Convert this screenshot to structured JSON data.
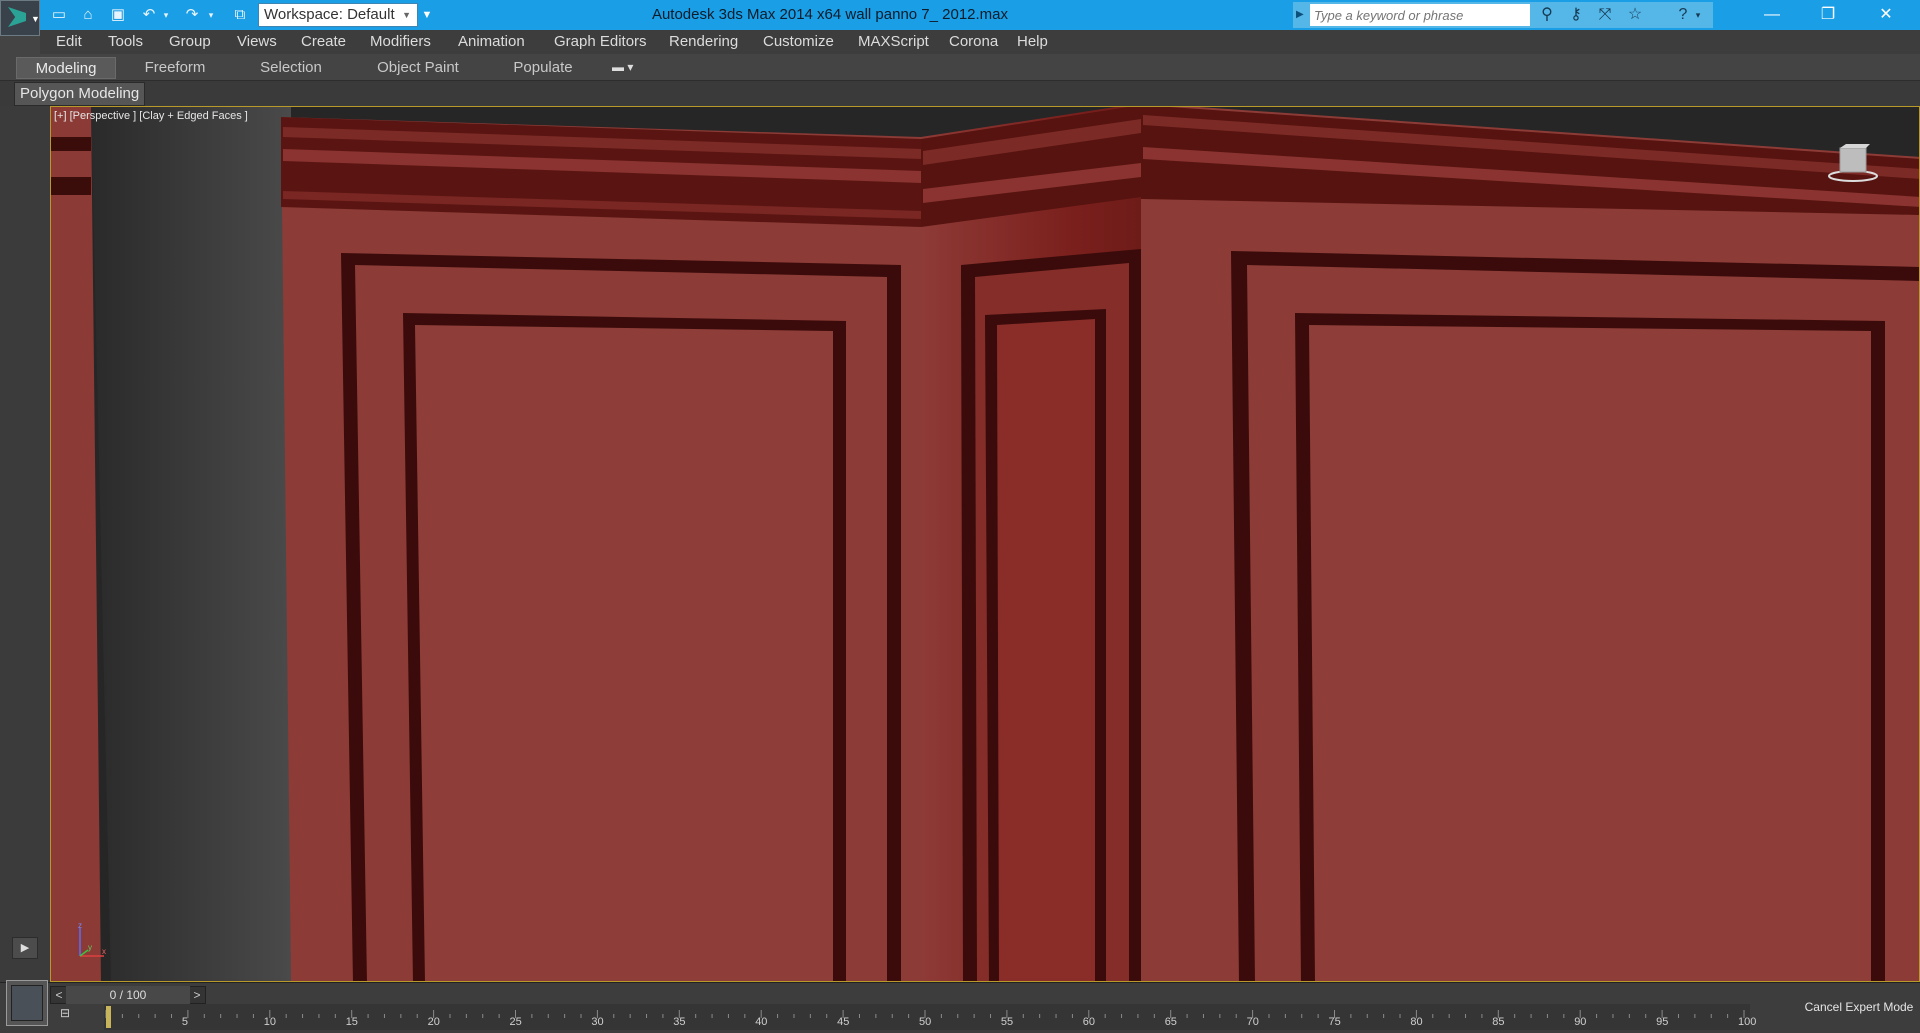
{
  "titlebar": {
    "app_title": "Autodesk 3ds Max  2014 x64      wall panno 7_ 2012.max",
    "workspace_label": "Workspace: Default",
    "search_placeholder": "Type a keyword or phrase",
    "quick_access": [
      "new-file-icon",
      "open-file-icon",
      "save-icon",
      "undo-icon",
      "redo-icon",
      "project-folder-icon"
    ]
  },
  "menu": {
    "items": [
      "Edit",
      "Tools",
      "Group",
      "Views",
      "Create",
      "Modifiers",
      "Animation",
      "Graph Editors",
      "Rendering",
      "Customize",
      "MAXScript",
      "Corona",
      "Help"
    ]
  },
  "ribbon": {
    "tabs": [
      "Modeling",
      "Freeform",
      "Selection",
      "Object Paint",
      "Populate"
    ],
    "active_tab": "Modeling",
    "panel_label": "Polygon Modeling"
  },
  "viewport": {
    "label": "[+] [Perspective ] [Clay + Edged Faces ]",
    "panel_color": "#8e3a36",
    "axis_labels": [
      "z",
      "y",
      "x"
    ]
  },
  "timeline": {
    "frame_display": "0 / 100",
    "tick_labels": [
      "5",
      "10",
      "15",
      "20",
      "25",
      "30",
      "35",
      "40",
      "45",
      "50",
      "55",
      "60",
      "65",
      "70",
      "75",
      "80",
      "85",
      "90",
      "95",
      "100"
    ],
    "expert_mode_label": "Cancel Expert Mode"
  },
  "colors": {
    "titlebar": "#1a9ee6",
    "viewport_border": "#b79a2a",
    "background": "#444444"
  }
}
